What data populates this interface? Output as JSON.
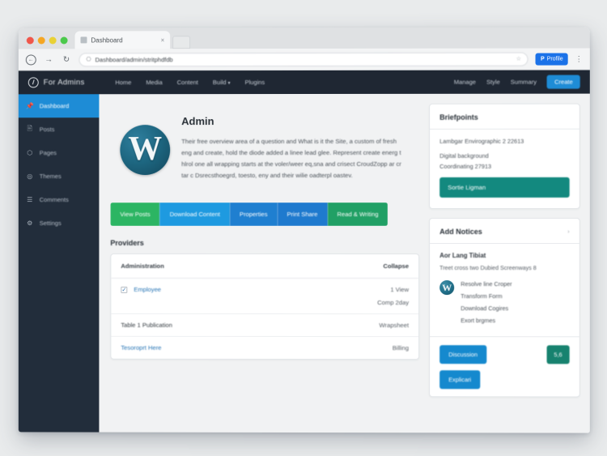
{
  "browser": {
    "tab": {
      "title": "Dashboard",
      "close_label": "×",
      "favicon": "page-icon"
    },
    "new_tab_label": "",
    "toolbar": {
      "back_icon": "←",
      "forward_icon": "→",
      "reload_icon": "↻",
      "lock_icon": "⎔",
      "url": "Dashboard/admin/stritphdfdb",
      "star_icon": "☆",
      "extension_button": {
        "icon": "P",
        "label": "Profile"
      },
      "menu_icon": "⋮"
    }
  },
  "adminbar": {
    "brand": "For Admins",
    "logo_icon": "wordpress-logo-icon",
    "nav": [
      {
        "label": "Home"
      },
      {
        "label": "Media"
      },
      {
        "label": "Content"
      },
      {
        "label": "Build",
        "caret": "▾"
      },
      {
        "label": "Plugins"
      }
    ],
    "right": [
      {
        "label": "Manage"
      },
      {
        "label": "Style"
      },
      {
        "label": "Summary"
      }
    ],
    "cta": "Create"
  },
  "sidebar": {
    "items": [
      {
        "label": "Dashboard",
        "icon": "📌",
        "active": true
      },
      {
        "label": "Posts",
        "icon": "🖹",
        "active": false
      },
      {
        "label": "Pages",
        "icon": "⬡",
        "active": false
      },
      {
        "label": "Themes",
        "icon": "◎",
        "active": false
      },
      {
        "label": "Comments",
        "icon": "☰",
        "active": false
      },
      {
        "label": "Settings",
        "icon": "⚙",
        "active": false
      }
    ]
  },
  "hero": {
    "title": "Admin",
    "logo_icon": "wordpress-w-logo",
    "logo_letter": "W",
    "paragraph": "Their free overview area of a question and What is it the Site, a custom of fresh eng and create, hold the diode added a linee lead glee. Represent create energ t hlrol one all wrapping starts at the voler/weer eq,sna and crisect CroudZopp ar cr tar c Dsrecsthoegrd, toesto, eny and their wilie oadterpl oastev."
  },
  "button_row": [
    {
      "label": "View Posts",
      "color": "green"
    },
    {
      "label": "Download Content",
      "color": "lblue"
    },
    {
      "label": "Properties",
      "color": "blue"
    },
    {
      "label": "Print Share",
      "color": "blue2"
    },
    {
      "label": "Read & Writing",
      "color": "green2"
    }
  ],
  "table": {
    "heading": "Providers",
    "columns": {
      "left": "Administration",
      "right": "Collapse"
    },
    "rows": [
      {
        "checkbox": "✓",
        "link": "Employee",
        "text": "",
        "right": "1 View",
        "right_sub": "Comp\n2day"
      },
      {
        "checkbox": "",
        "link": "",
        "text": "Table 1 Publication",
        "right": "Wrapsheet",
        "right_sub": ""
      },
      {
        "checkbox": "",
        "link": "Tesoroprt Here",
        "text": "",
        "right": "Billing",
        "right_sub": ""
      }
    ]
  },
  "right_cards": [
    {
      "title": "Briefpoints",
      "lines": [
        "Lambgar  Envirographic 2 22613",
        "Digital background",
        "Coordinating  27913"
      ],
      "button": "Sortie Ligman"
    },
    {
      "title": "Add Notices",
      "chevron": "›",
      "sub_head": "Aor Lang Tibiat",
      "sub_text": "Treet cross two Dubied Screenways 8",
      "plugin": {
        "logo_icon": "wordpress-mini-logo",
        "logo_letter": "W",
        "lines": [
          "Resolve line Croper",
          "Transform Form",
          "Download Cogires",
          "Exort brgmes"
        ]
      },
      "buttons": {
        "primary": "Discussion",
        "secondary": "5,6",
        "tertiary": "Explicari"
      }
    }
  ]
}
